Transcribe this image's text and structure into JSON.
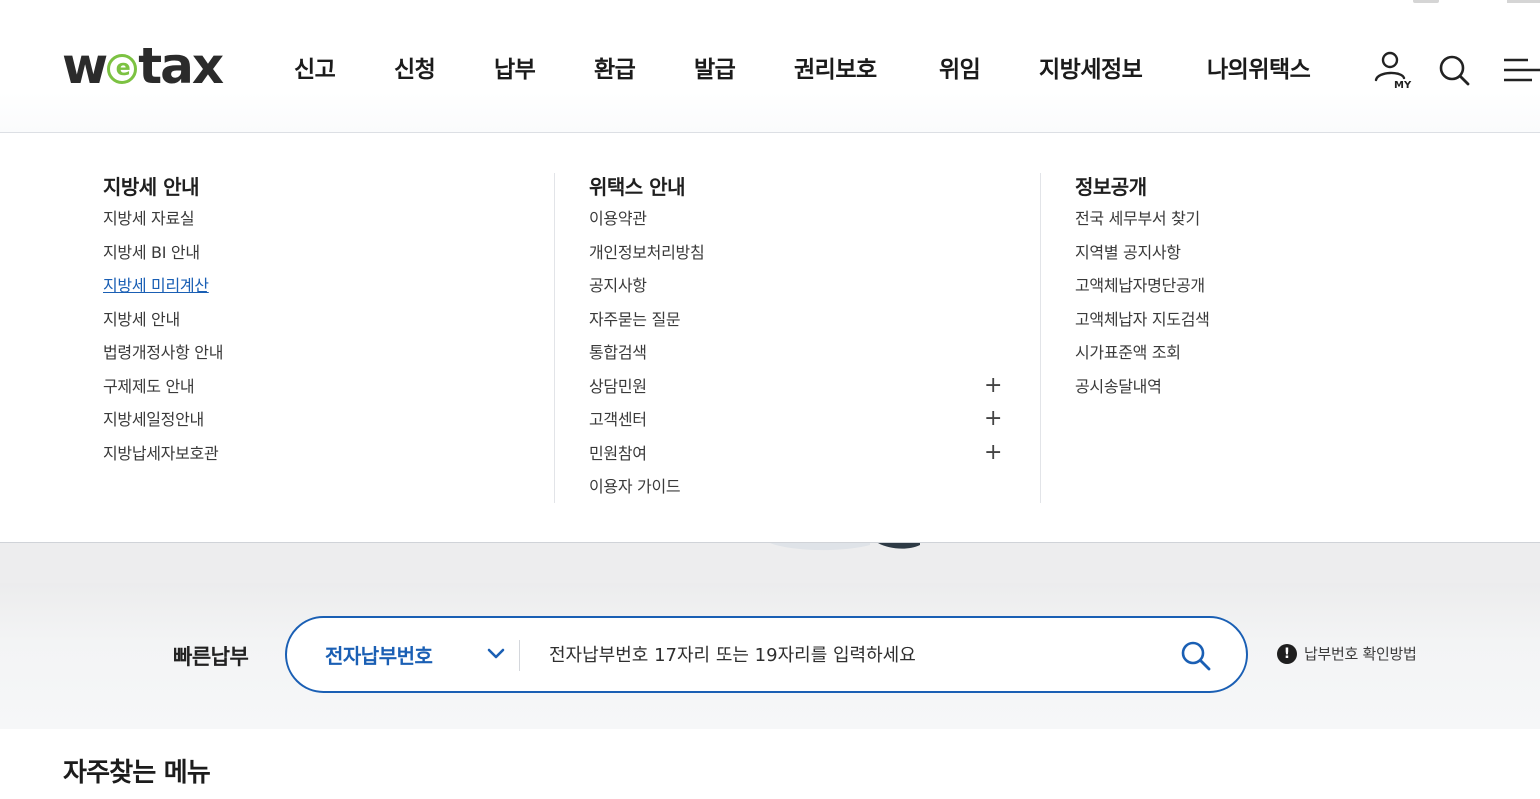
{
  "brand": {
    "logo_before": "w",
    "logo_e": "e",
    "logo_after": "tax"
  },
  "nav": {
    "items": [
      "신고",
      "신청",
      "납부",
      "환급",
      "발급",
      "권리보호",
      "위임",
      "지방세정보",
      "나의위택스"
    ]
  },
  "header_icons": {
    "my_badge": "MY",
    "icons": [
      "user-my-icon",
      "search-icon",
      "menu-icon"
    ]
  },
  "mega_menu": {
    "columns": [
      {
        "title": "지방세 안내",
        "items": [
          {
            "label": "지방세 자료실"
          },
          {
            "label": "지방세 BI 안내"
          },
          {
            "label": "지방세 미리계산",
            "active": true
          },
          {
            "label": "지방세 안내"
          },
          {
            "label": "법령개정사항 안내"
          },
          {
            "label": "구제제도 안내"
          },
          {
            "label": "지방세일정안내"
          },
          {
            "label": "지방납세자보호관"
          }
        ]
      },
      {
        "title": "위택스 안내",
        "items": [
          {
            "label": "이용약관"
          },
          {
            "label": "개인정보처리방침"
          },
          {
            "label": "공지사항"
          },
          {
            "label": "자주묻는 질문"
          },
          {
            "label": "통합검색"
          },
          {
            "label": "상담민원",
            "expandable": true
          },
          {
            "label": "고객센터",
            "expandable": true
          },
          {
            "label": "민원참여",
            "expandable": true
          },
          {
            "label": "이용자 가이드"
          }
        ]
      },
      {
        "title": "정보공개",
        "items": [
          {
            "label": "전국 세무부서 찾기"
          },
          {
            "label": "지역별 공지사항"
          },
          {
            "label": "고액체납자명단공개"
          },
          {
            "label": "고액체납자 지도검색"
          },
          {
            "label": "시가표준액 조회"
          },
          {
            "label": "공시송달내역"
          }
        ]
      }
    ],
    "expand_symbol": "+"
  },
  "quick_pay": {
    "label": "빠른납부",
    "select_value": "전자납부번호",
    "input_placeholder": "전자납부번호 17자리 또는 19자리를 입력하세요",
    "input_value": "",
    "help_icon": "!",
    "help_text": "납부번호 확인방법"
  },
  "frequent": {
    "title": "자주찾는 메뉴"
  },
  "colors": {
    "primary": "#1a5fb4",
    "logo_green": "#7cc242",
    "text": "#222222"
  }
}
